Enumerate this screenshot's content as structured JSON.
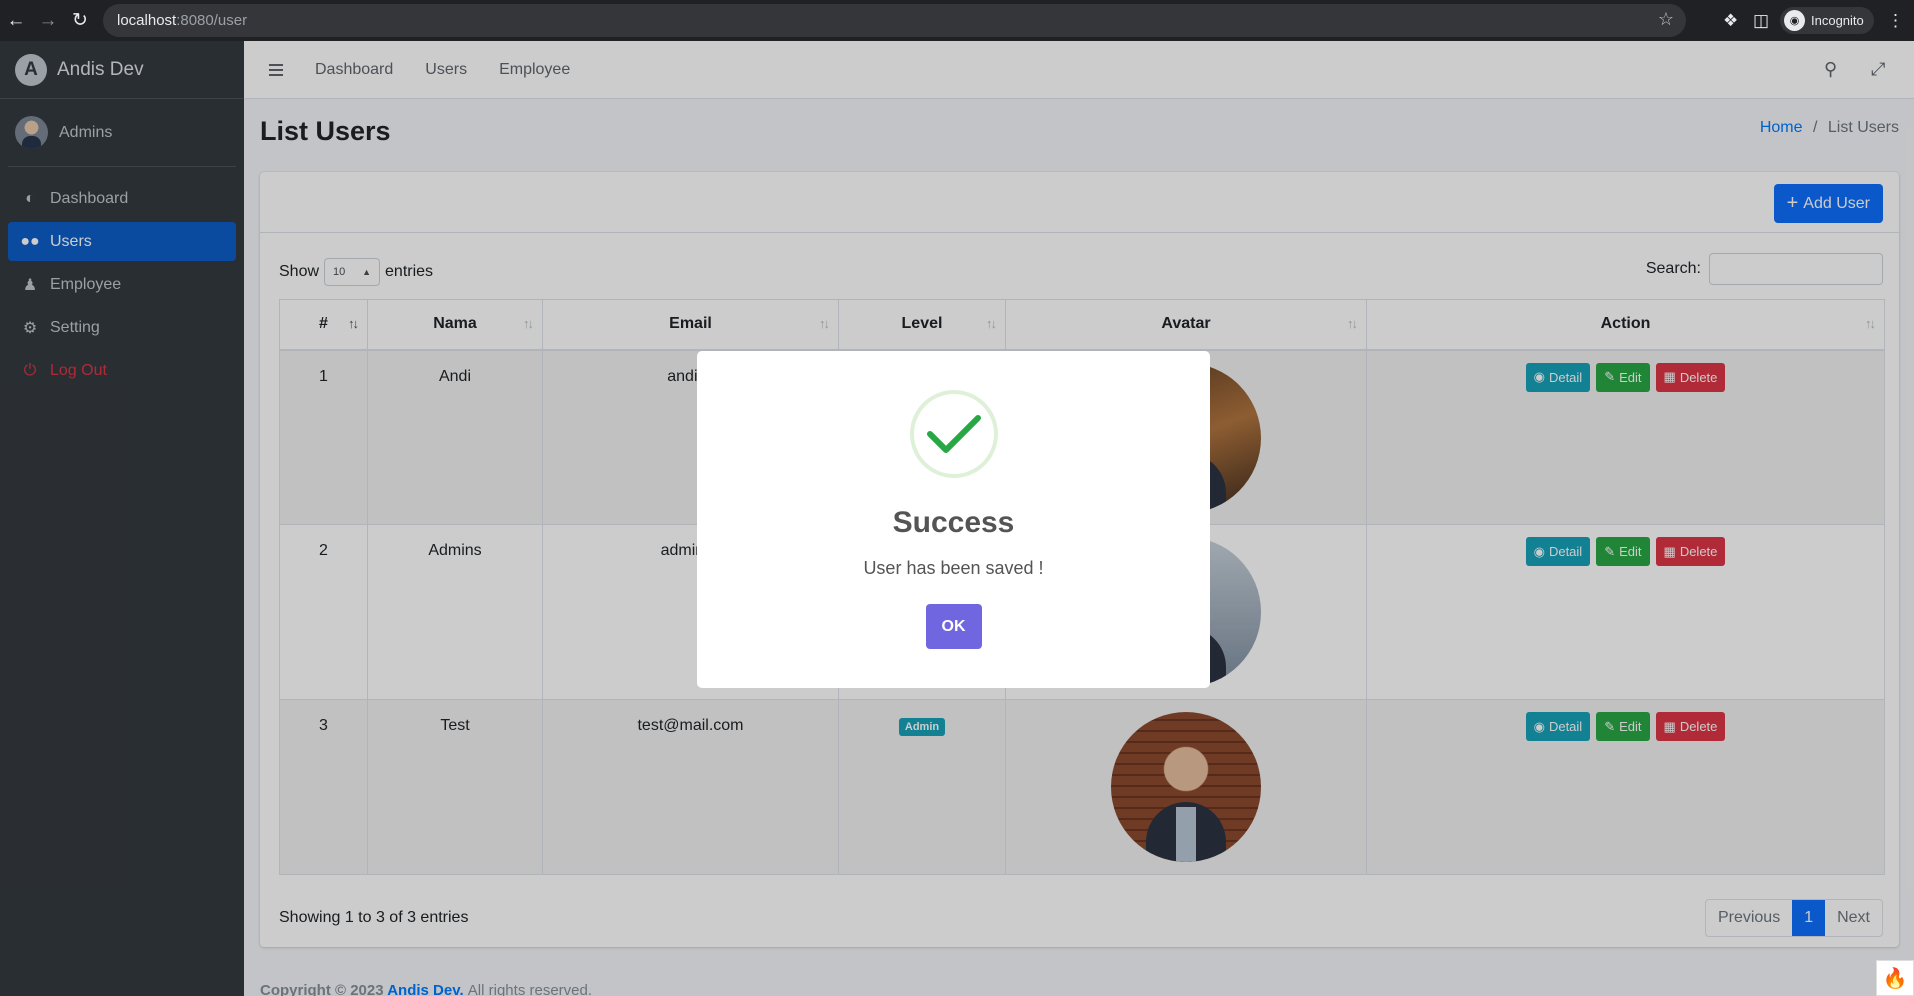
{
  "browser": {
    "url_host": "localhost",
    "url_path": ":8080/user",
    "profile_label": "Incognito"
  },
  "sidebar": {
    "brand": "Andis Dev",
    "brand_logo_letter": "A",
    "user_name": "Admins",
    "items": [
      {
        "label": "Dashboard",
        "icon": "dashboard-icon"
      },
      {
        "label": "Users",
        "icon": "users-icon",
        "active": true
      },
      {
        "label": "Employee",
        "icon": "employee-icon"
      },
      {
        "label": "Setting",
        "icon": "gear-icon"
      },
      {
        "label": "Log Out",
        "icon": "power-icon"
      }
    ]
  },
  "topnav": {
    "links": [
      "Dashboard",
      "Users",
      "Employee"
    ]
  },
  "page": {
    "title": "List Users",
    "breadcrumb_home": "Home",
    "breadcrumb_separator": "/",
    "breadcrumb_current": "List Users"
  },
  "card": {
    "add_button": "Add User",
    "show_label": "Show",
    "entries_value": "10",
    "entries_label": "entries",
    "search_label": "Search:",
    "columns": [
      "#",
      "Nama",
      "Email",
      "Level",
      "Avatar",
      "Action"
    ],
    "rows": [
      {
        "no": "1",
        "nama": "Andi",
        "email": "andi@",
        "level": ""
      },
      {
        "no": "2",
        "nama": "Admins",
        "email": "admin@",
        "level": ""
      },
      {
        "no": "3",
        "nama": "Test",
        "email": "test@mail.com",
        "level": "Admin"
      }
    ],
    "action_detail": "Detail",
    "action_edit": "Edit",
    "action_delete": "Delete",
    "info": "Showing 1 to 3 of 3 entries",
    "pager": {
      "prev": "Previous",
      "current": "1",
      "next": "Next"
    }
  },
  "footer": {
    "prefix": "Copyright © 2023",
    "brand": "Andis Dev.",
    "suffix": "All rights reserved."
  },
  "modal": {
    "title": "Success",
    "text": "User has been saved !",
    "ok": "OK"
  },
  "colors": {
    "sidebar_bg": "#343a40",
    "active": "#0d5ec8",
    "primary": "#0d6efd",
    "info": "#17a2b8",
    "success": "#28a745",
    "danger": "#dc3545",
    "ok_button": "#7066e0"
  }
}
